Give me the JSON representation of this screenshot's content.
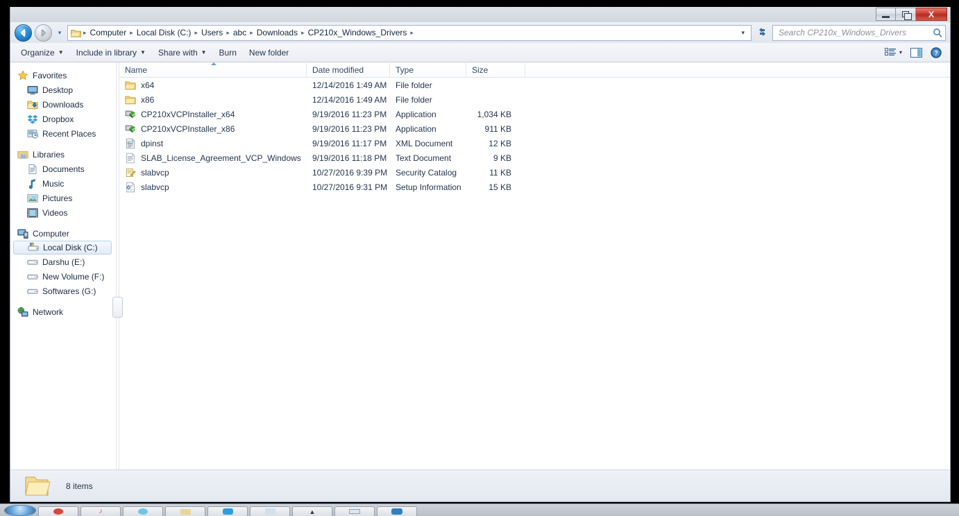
{
  "window": {
    "title": "",
    "buttons": {
      "minimize": "minimize",
      "restore": "restore",
      "close": "X"
    }
  },
  "address_bar": {
    "back_label": "Back",
    "forward_label": "Forward",
    "history_label": "Recent pages",
    "breadcrumbs": [
      "Computer",
      "Local Disk (C:)",
      "Users",
      "abc",
      "Downloads",
      "CP210x_Windows_Drivers"
    ],
    "separator": "▸",
    "dropdown": "▾",
    "refresh_label": "Refresh",
    "search_placeholder": "Search CP210x_Windows_Drivers"
  },
  "command_bar": {
    "items": [
      {
        "label": "Organize",
        "has_caret": true
      },
      {
        "label": "Include in library",
        "has_caret": true
      },
      {
        "label": "Share with",
        "has_caret": true
      },
      {
        "label": "Burn",
        "has_caret": false
      },
      {
        "label": "New folder",
        "has_caret": false
      }
    ],
    "view_label": "Change your view",
    "view_caret": "▾",
    "preview_label": "Show the preview pane",
    "help_label": "Get help",
    "help_glyph": "?"
  },
  "sidebar": {
    "groups": [
      {
        "header": {
          "label": "Favorites",
          "icon": "star-icon"
        },
        "items": [
          {
            "label": "Desktop",
            "icon": "desktop-icon"
          },
          {
            "label": "Downloads",
            "icon": "downloads-folder-icon"
          },
          {
            "label": "Dropbox",
            "icon": "dropbox-icon"
          },
          {
            "label": "Recent Places",
            "icon": "recent-places-icon"
          }
        ]
      },
      {
        "header": {
          "label": "Libraries",
          "icon": "libraries-icon"
        },
        "items": [
          {
            "label": "Documents",
            "icon": "documents-icon"
          },
          {
            "label": "Music",
            "icon": "music-icon"
          },
          {
            "label": "Pictures",
            "icon": "pictures-icon"
          },
          {
            "label": "Videos",
            "icon": "videos-icon"
          }
        ]
      },
      {
        "header": {
          "label": "Computer",
          "icon": "computer-icon"
        },
        "items": [
          {
            "label": "Local Disk (C:)",
            "icon": "hard-disk-icon",
            "selected": true
          },
          {
            "label": "Darshu (E:)",
            "icon": "drive-icon"
          },
          {
            "label": "New Volume (F:)",
            "icon": "drive-icon"
          },
          {
            "label": "Softwares (G:)",
            "icon": "drive-icon"
          }
        ]
      },
      {
        "header": {
          "label": "Network",
          "icon": "network-icon"
        },
        "items": []
      }
    ]
  },
  "file_list": {
    "columns": [
      "Name",
      "Date modified",
      "Type",
      "Size"
    ],
    "sort_column": "Name",
    "sort_direction": "ascending",
    "rows": [
      {
        "name": "x64",
        "date": "12/14/2016 1:49 AM",
        "type": "File folder",
        "size": "",
        "icon": "folder-icon"
      },
      {
        "name": "x86",
        "date": "12/14/2016 1:49 AM",
        "type": "File folder",
        "size": "",
        "icon": "folder-icon"
      },
      {
        "name": "CP210xVCPInstaller_x64",
        "date": "9/19/2016 11:23 PM",
        "type": "Application",
        "size": "1,034 KB",
        "icon": "application-icon"
      },
      {
        "name": "CP210xVCPInstaller_x86",
        "date": "9/19/2016 11:23 PM",
        "type": "Application",
        "size": "911 KB",
        "icon": "application-icon"
      },
      {
        "name": "dpinst",
        "date": "9/19/2016 11:17 PM",
        "type": "XML Document",
        "size": "12 KB",
        "icon": "xml-document-icon"
      },
      {
        "name": "SLAB_License_Agreement_VCP_Windows",
        "date": "9/19/2016 11:18 PM",
        "type": "Text Document",
        "size": "9 KB",
        "icon": "text-document-icon"
      },
      {
        "name": "slabvcp",
        "date": "10/27/2016 9:39 PM",
        "type": "Security Catalog",
        "size": "11 KB",
        "icon": "security-catalog-icon"
      },
      {
        "name": "slabvcp",
        "date": "10/27/2016 9:31 PM",
        "type": "Setup Information",
        "size": "15 KB",
        "icon": "setup-information-icon"
      }
    ]
  },
  "status_bar": {
    "icon": "open-folder-icon",
    "item_count": "8 items"
  },
  "colors": {
    "accent_blue": "#2a8fd8",
    "close_red": "#c8372c",
    "folder_yellow": "#fcd97a",
    "selection_blue": "#e2ebf7",
    "title_bar": "#d4d8e1"
  }
}
